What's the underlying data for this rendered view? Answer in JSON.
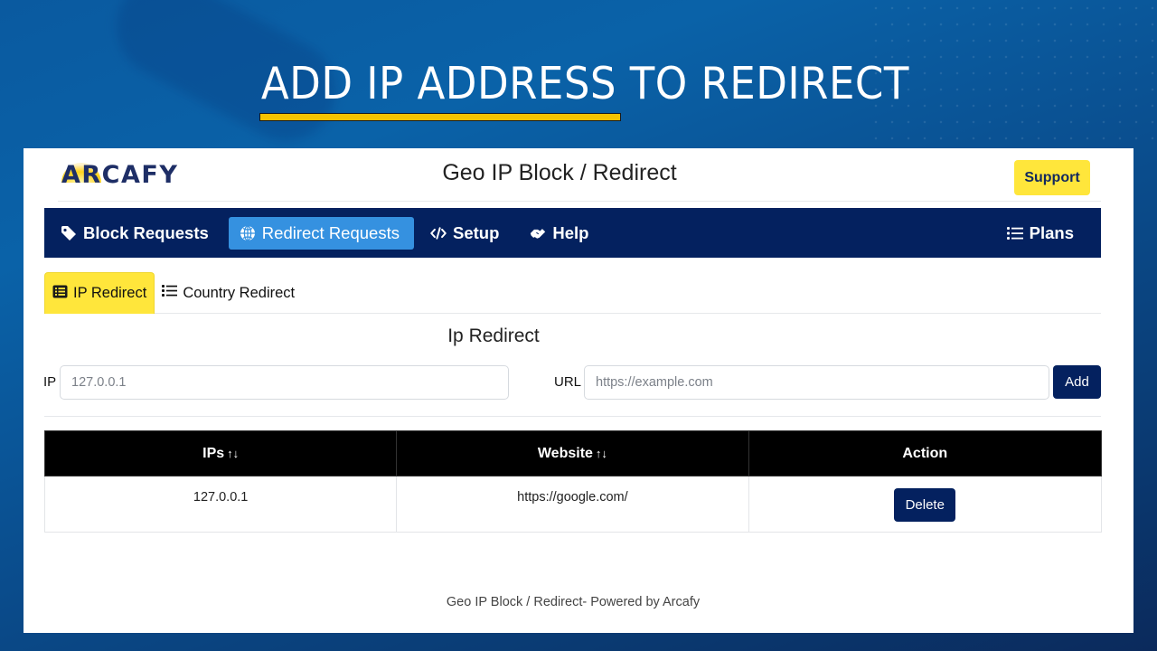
{
  "slide": {
    "title": "ADD IP ADDRESS TO REDIRECT",
    "accent_color": "#f5c300"
  },
  "header": {
    "logo_text": "ARCAFY",
    "app_title": "Geo IP Block / Redirect",
    "support_label": "Support"
  },
  "nav": {
    "items": [
      {
        "label": "Block Requests",
        "icon": "tag-icon",
        "active": false
      },
      {
        "label": "Redirect Requests",
        "icon": "globe-icon",
        "active": true
      },
      {
        "label": "Setup",
        "icon": "code-icon",
        "active": false
      },
      {
        "label": "Help",
        "icon": "handshake-icon",
        "active": false
      }
    ],
    "right_item": {
      "label": "Plans",
      "icon": "list-icon"
    }
  },
  "tabs": [
    {
      "label": "IP Redirect",
      "icon": "table-list-icon",
      "active": true
    },
    {
      "label": "Country Redirect",
      "icon": "list-icon",
      "active": false
    }
  ],
  "form": {
    "section_title": "Ip Redirect",
    "ip_label": "IP",
    "ip_value": "",
    "ip_placeholder": "127.0.0.1",
    "url_label": "URL",
    "url_value": "",
    "url_placeholder": "https://example.com",
    "add_label": "Add"
  },
  "table": {
    "columns": [
      {
        "label": "IPs",
        "sortable": true
      },
      {
        "label": "Website",
        "sortable": true
      },
      {
        "label": "Action",
        "sortable": false
      }
    ],
    "sort_glyph": "↑↓",
    "rows": [
      {
        "ip": "127.0.0.1",
        "website": "https://google.com/",
        "action_label": "Delete"
      }
    ]
  },
  "footer": {
    "text": "Geo IP Block / Redirect- Powered by Arcafy"
  },
  "colors": {
    "navy": "#04215f",
    "active_nav": "#3591e0",
    "yellow": "#ffe63b"
  }
}
